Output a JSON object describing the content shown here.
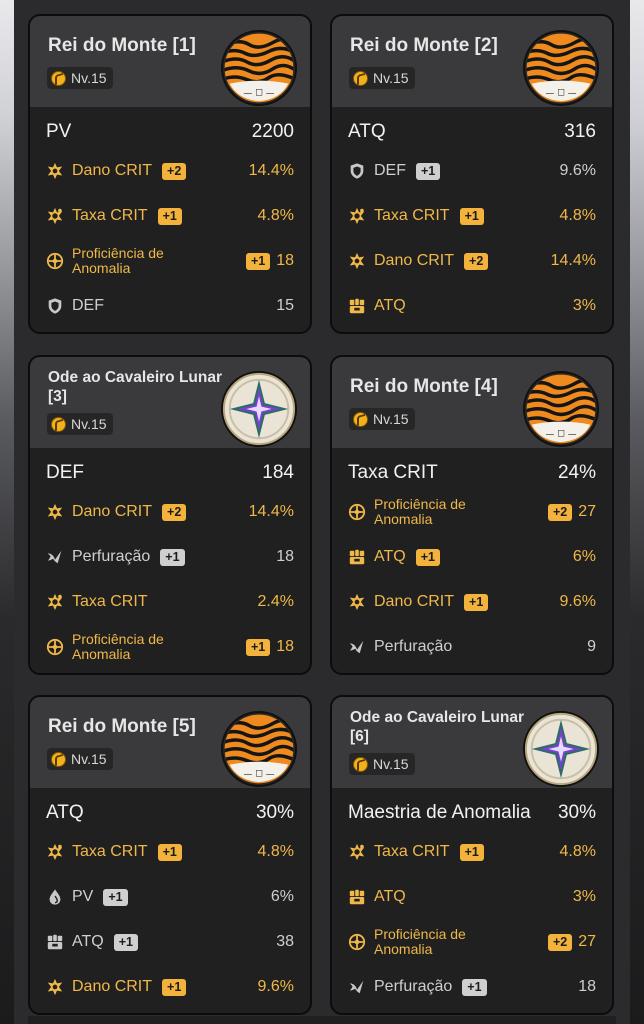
{
  "cards": [
    {
      "title": "Rei do Monte [1]",
      "level": "Nv.15",
      "disc": "tiger",
      "main": {
        "name": "PV",
        "value": "2200"
      },
      "subs": [
        {
          "icon": "crit-dmg-icon",
          "name": "Dano CRIT",
          "badge": "+2",
          "value": "14.4%",
          "hi": true
        },
        {
          "icon": "crit-rate-icon",
          "name": "Taxa CRIT",
          "badge": "+1",
          "value": "4.8%",
          "hi": true
        },
        {
          "icon": "anomaly-icon",
          "name": "Proficiência de Anomalia",
          "badge": "+1",
          "value": "18",
          "hi": true
        },
        {
          "icon": "def-icon",
          "name": "DEF",
          "badge": "",
          "value": "15",
          "hi": false
        }
      ]
    },
    {
      "title": "Rei do Monte [2]",
      "level": "Nv.15",
      "disc": "tiger",
      "main": {
        "name": "ATQ",
        "value": "316"
      },
      "subs": [
        {
          "icon": "def-icon",
          "name": "DEF",
          "badge": "+1",
          "value": "9.6%",
          "hi": false
        },
        {
          "icon": "crit-rate-icon",
          "name": "Taxa CRIT",
          "badge": "+1",
          "value": "4.8%",
          "hi": true
        },
        {
          "icon": "crit-dmg-icon",
          "name": "Dano CRIT",
          "badge": "+2",
          "value": "14.4%",
          "hi": true
        },
        {
          "icon": "atk-icon",
          "name": "ATQ",
          "badge": "",
          "value": "3%",
          "hi": true
        }
      ]
    },
    {
      "title": "Ode ao Cavaleiro Lunar [3]",
      "level": "Nv.15",
      "disc": "star",
      "main": {
        "name": "DEF",
        "value": "184"
      },
      "subs": [
        {
          "icon": "crit-dmg-icon",
          "name": "Dano CRIT",
          "badge": "+2",
          "value": "14.4%",
          "hi": true
        },
        {
          "icon": "pen-icon",
          "name": "Perfuração",
          "badge": "+1",
          "value": "18",
          "hi": false
        },
        {
          "icon": "crit-rate-icon",
          "name": "Taxa CRIT",
          "badge": "",
          "value": "2.4%",
          "hi": true
        },
        {
          "icon": "anomaly-icon",
          "name": "Proficiência de Anomalia",
          "badge": "+1",
          "value": "18",
          "hi": true
        }
      ]
    },
    {
      "title": "Rei do Monte [4]",
      "level": "Nv.15",
      "disc": "tiger",
      "main": {
        "name": "Taxa CRIT",
        "value": "24%"
      },
      "subs": [
        {
          "icon": "anomaly-icon",
          "name": "Proficiência de Anomalia",
          "badge": "+2",
          "value": "27",
          "hi": true
        },
        {
          "icon": "atk-icon",
          "name": "ATQ",
          "badge": "+1",
          "value": "6%",
          "hi": true
        },
        {
          "icon": "crit-dmg-icon",
          "name": "Dano CRIT",
          "badge": "+1",
          "value": "9.6%",
          "hi": true
        },
        {
          "icon": "pen-icon",
          "name": "Perfuração",
          "badge": "",
          "value": "9",
          "hi": false
        }
      ]
    },
    {
      "title": "Rei do Monte [5]",
      "level": "Nv.15",
      "disc": "tiger",
      "main": {
        "name": "ATQ",
        "value": "30%"
      },
      "subs": [
        {
          "icon": "crit-rate-icon",
          "name": "Taxa CRIT",
          "badge": "+1",
          "value": "4.8%",
          "hi": true
        },
        {
          "icon": "hp-icon",
          "name": "PV",
          "badge": "+1",
          "value": "6%",
          "hi": false
        },
        {
          "icon": "atk-icon",
          "name": "ATQ",
          "badge": "+1",
          "value": "38",
          "hi": false
        },
        {
          "icon": "crit-dmg-icon",
          "name": "Dano CRIT",
          "badge": "+1",
          "value": "9.6%",
          "hi": true
        }
      ]
    },
    {
      "title": "Ode ao Cavaleiro Lunar [6]",
      "level": "Nv.15",
      "disc": "star",
      "main": {
        "name": "Maestria de Anomalia",
        "value": "30%"
      },
      "subs": [
        {
          "icon": "crit-rate-icon",
          "name": "Taxa CRIT",
          "badge": "+1",
          "value": "4.8%",
          "hi": true
        },
        {
          "icon": "atk-icon",
          "name": "ATQ",
          "badge": "",
          "value": "3%",
          "hi": true
        },
        {
          "icon": "anomaly-icon",
          "name": "Proficiência de Anomalia",
          "badge": "+2",
          "value": "27",
          "hi": true
        },
        {
          "icon": "pen-icon",
          "name": "Perfuração",
          "badge": "+1",
          "value": "18",
          "hi": false
        }
      ]
    }
  ]
}
